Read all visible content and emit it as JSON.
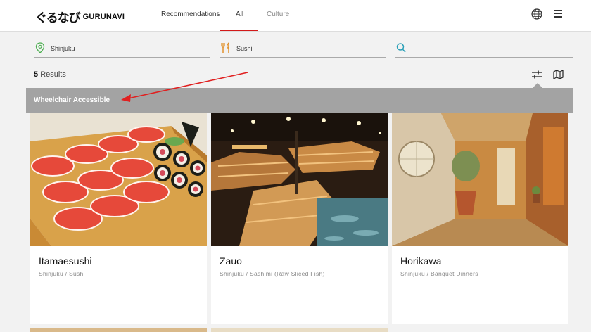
{
  "header": {
    "logo_mark": "ぐるなび",
    "logo_text": "GURUNAVI",
    "tabs": [
      {
        "label": "Recommendations",
        "active": false
      },
      {
        "label": "All",
        "active": true
      },
      {
        "label": "Culture",
        "active": false
      }
    ],
    "icons": [
      "globe-icon",
      "hamburger-menu-icon"
    ]
  },
  "search": {
    "location": "Shinjuku",
    "cuisine": "Sushi",
    "keyword": "",
    "keyword_placeholder": ""
  },
  "results": {
    "count": "5",
    "label": "Results"
  },
  "banner": {
    "text": "Wheelchair Accessible"
  },
  "cards": [
    {
      "name": "Itamaesushi",
      "subtitle": "Shinjuku / Sushi"
    },
    {
      "name": "Zauo",
      "subtitle": "Shinjuku / Sashimi (Raw Sliced Fish)"
    },
    {
      "name": "Horikawa",
      "subtitle": "Shinjuku / Banquet Dinners"
    }
  ],
  "colors": {
    "accent": "#d31a1a",
    "banner_bg": "#a3a3a3",
    "location_pin": "#4caf50",
    "cuisine_icon": "#e08a1e",
    "search_icon": "#2aa0b8",
    "annotation_arrow": "#e02020"
  }
}
